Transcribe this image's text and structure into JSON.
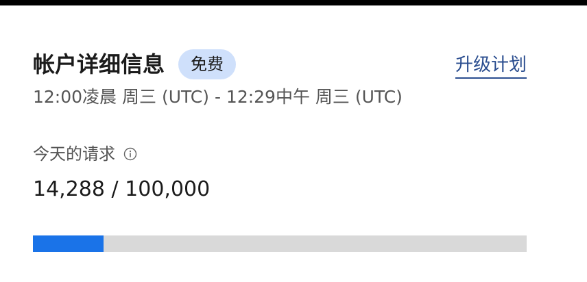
{
  "account": {
    "title": "帐户详细信息",
    "plan_badge": "免费",
    "upgrade_label": "升级计划",
    "time_range": "12:00凌晨 周三 (UTC) - 12:29中午 周三 (UTC)"
  },
  "requests": {
    "label": "今天的请求",
    "info_icon": "info-icon",
    "value_text": "14,288 / 100,000",
    "used": 14288,
    "limit": 100000,
    "progress_fraction": 0.14288
  },
  "colors": {
    "accent": "#1a73e8",
    "badge_bg": "#cfe0fb",
    "link": "#2a4d8f",
    "track": "#d9d9d9"
  }
}
